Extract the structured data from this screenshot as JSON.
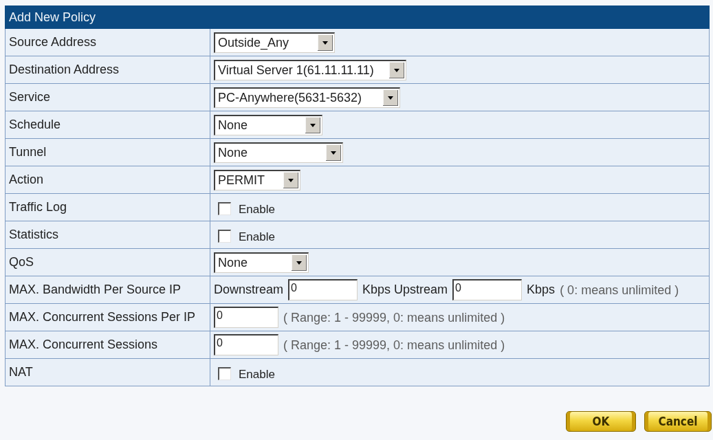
{
  "form": {
    "title": "Add New Policy",
    "rows": [
      {
        "label": "Source Address",
        "controls": [
          {
            "kind": "select",
            "value": "Outside_Any"
          }
        ]
      },
      {
        "label": "Destination Address",
        "controls": [
          {
            "kind": "select",
            "value": "Virtual Server 1(61.11.11.11)"
          }
        ]
      },
      {
        "label": "Service",
        "controls": [
          {
            "kind": "select",
            "value": "PC-Anywhere(5631-5632)"
          }
        ]
      },
      {
        "label": "Schedule",
        "controls": [
          {
            "kind": "select",
            "value": "None"
          }
        ]
      },
      {
        "label": "Tunnel",
        "controls": [
          {
            "kind": "select",
            "value": "None"
          }
        ]
      },
      {
        "label": "Action",
        "controls": [
          {
            "kind": "select",
            "value": "PERMIT"
          }
        ]
      },
      {
        "label": "Traffic Log",
        "controls": [
          {
            "kind": "checkbox",
            "checked": false,
            "text": "Enable"
          }
        ]
      },
      {
        "label": "Statistics",
        "controls": [
          {
            "kind": "checkbox",
            "checked": false,
            "text": "Enable"
          }
        ]
      },
      {
        "label": "QoS",
        "controls": [
          {
            "kind": "select",
            "value": "None"
          }
        ]
      },
      {
        "label": "MAX. Bandwidth Per Source IP",
        "controls": [
          {
            "kind": "text",
            "text": "Downstream"
          },
          {
            "kind": "input",
            "value": "0"
          },
          {
            "kind": "text",
            "text": "Kbps Upstream"
          },
          {
            "kind": "input",
            "value": "0"
          },
          {
            "kind": "text",
            "text": "Kbps"
          },
          {
            "kind": "hint",
            "text": "( 0: means unlimited )"
          }
        ]
      },
      {
        "label": "MAX. Concurrent Sessions Per IP",
        "controls": [
          {
            "kind": "input",
            "value": "0"
          },
          {
            "kind": "hint",
            "text": "( Range: 1 - 99999, 0: means unlimited )"
          }
        ]
      },
      {
        "label": "MAX. Concurrent Sessions",
        "controls": [
          {
            "kind": "input",
            "value": "0"
          },
          {
            "kind": "hint",
            "text": "( Range: 1 - 99999, 0: means unlimited )"
          }
        ]
      },
      {
        "label": "NAT",
        "controls": [
          {
            "kind": "checkbox",
            "checked": false,
            "text": "Enable"
          }
        ]
      }
    ]
  },
  "buttons": [
    {
      "label": "OK"
    },
    {
      "label": "Cancel"
    }
  ]
}
